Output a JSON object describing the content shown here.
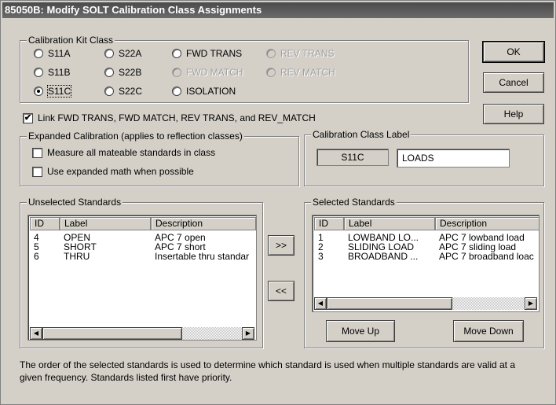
{
  "window": {
    "title": "85050B: Modify SOLT Calibration Class Assignments"
  },
  "kit_class": {
    "legend": "Calibration Kit Class",
    "options": [
      {
        "label": "S11A",
        "checked": false,
        "disabled": false
      },
      {
        "label": "S22A",
        "checked": false,
        "disabled": false
      },
      {
        "label": "FWD TRANS",
        "checked": false,
        "disabled": false
      },
      {
        "label": "REV TRANS",
        "checked": false,
        "disabled": true
      },
      {
        "label": "S11B",
        "checked": false,
        "disabled": false
      },
      {
        "label": "S22B",
        "checked": false,
        "disabled": false
      },
      {
        "label": "FWD MATCH",
        "checked": false,
        "disabled": true
      },
      {
        "label": "REV MATCH",
        "checked": false,
        "disabled": true
      },
      {
        "label": "S11C",
        "checked": true,
        "disabled": false
      },
      {
        "label": "S22C",
        "checked": false,
        "disabled": false
      },
      {
        "label": "ISOLATION",
        "checked": false,
        "disabled": false
      }
    ]
  },
  "buttons": {
    "ok": "OK",
    "cancel": "Cancel",
    "help": "Help",
    "add": ">>",
    "remove": "<<",
    "move_up": "Move Up",
    "move_down": "Move Down"
  },
  "link_checkbox": {
    "label": "Link FWD TRANS, FWD MATCH, REV TRANS, and REV_MATCH",
    "checked": true
  },
  "expanded": {
    "legend": "Expanded Calibration (applies to reflection classes)",
    "measure_all": {
      "label": "Measure all mateable standards in class",
      "checked": false
    },
    "expanded_math": {
      "label": "Use expanded math when possible",
      "checked": false
    }
  },
  "class_label": {
    "legend": "Calibration Class Label",
    "class_name": "S11C",
    "value": "LOADS"
  },
  "unselected": {
    "legend": "Unselected Standards",
    "columns": [
      "ID",
      "Label",
      "Description"
    ],
    "rows": [
      {
        "id": "4",
        "label": "OPEN",
        "desc": "APC 7  open"
      },
      {
        "id": "5",
        "label": "SHORT",
        "desc": "APC 7  short"
      },
      {
        "id": "6",
        "label": "THRU",
        "desc": "Insertable thru standar"
      }
    ]
  },
  "selected": {
    "legend": "Selected Standards",
    "columns": [
      "ID",
      "Label",
      "Description"
    ],
    "rows": [
      {
        "id": "1",
        "label": "LOWBAND LO...",
        "desc": "APC 7 lowband load"
      },
      {
        "id": "2",
        "label": "SLIDING LOAD",
        "desc": "APC 7 sliding load"
      },
      {
        "id": "3",
        "label": "BROADBAND ...",
        "desc": "APC 7 broadband loac"
      }
    ]
  },
  "footnote": "The order of the selected standards is used to determine which standard is used when multiple standards are valid at a given frequency. Standards listed first have priority."
}
